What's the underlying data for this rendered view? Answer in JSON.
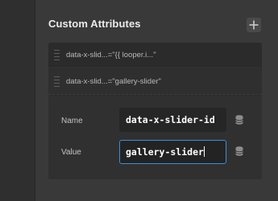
{
  "section": {
    "title": "Custom Attributes",
    "add_icon": "plus-icon"
  },
  "attributes": [
    {
      "text": "data-x-slid...=\"{{ looper.i...\""
    },
    {
      "text": "data-x-slid...=\"gallery-slider\""
    }
  ],
  "editor": {
    "name_label": "Name",
    "name_value": "data-x-slider-id",
    "value_label": "Value",
    "value_value": "gallery-slider",
    "dynamic_content_icon": "database-icon"
  },
  "colors": {
    "focus_border": "#3a8fd9"
  }
}
